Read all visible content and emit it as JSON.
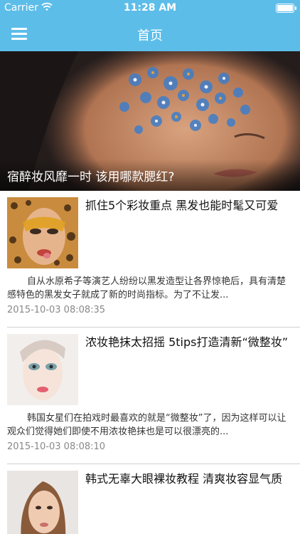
{
  "status_bar": {
    "carrier": "Carrier",
    "time": "11:28 AM"
  },
  "nav": {
    "title": "首页",
    "menu_icon": "hamburger-menu-icon"
  },
  "hero": {
    "caption": "宿醉妆风靡一时 该用哪款腮红?"
  },
  "articles": [
    {
      "title": "抓住5个彩妆重点 黑发也能时髦又可爱",
      "summary": "自从水原希子等演艺人纷纷以黑发造型让各界惊艳后，具有清楚感特色的黑发女子就成了新的时尚指标。为了不让发...",
      "date": "2015-10-03 08:08:35"
    },
    {
      "title": "浓妆艳抹太招摇 5tips打造清新“微整妆”",
      "summary": "韩国女星们在拍戏时最喜欢的就是“微整妆”了，因为这样可以让观众们觉得她们即使不用浓妆艳抹也是可以很漂亮的...",
      "date": "2015-10-03 08:08:10"
    },
    {
      "title": "韩式无辜大眼裸妆教程 清爽妆容显气质"
    }
  ]
}
